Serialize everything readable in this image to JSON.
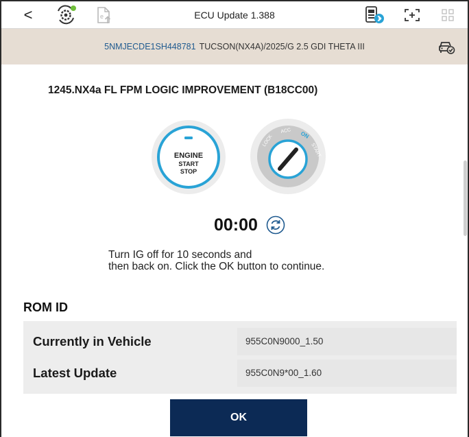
{
  "toolbar": {
    "back_glyph": "<",
    "title": "ECU Update 1.388",
    "icons": [
      "back-icon",
      "scan-gear-icon",
      "upload-file-icon",
      "bluetooth-vci-icon",
      "capture-icon",
      "grid-icon"
    ]
  },
  "vehicle": {
    "vin": "5NMJECDE1SH448781",
    "model": "TUCSON(NX4A)/2025/G 2.5 GDI THETA III"
  },
  "update": {
    "title": "1245.NX4a FL FPM LOGIC IMPROVEMENT (B18CC00)",
    "engine_button": {
      "line1": "ENGINE",
      "line2": "START",
      "line3": "STOP"
    },
    "key_positions": [
      "LOCK",
      "ACC",
      "ON",
      "START"
    ],
    "key_active_position": "ON",
    "timer": "00:00",
    "instruction": "Turn IG off for 10 seconds and\nthen back on. Click the OK button to continue."
  },
  "rom": {
    "label": "ROM ID",
    "rows": [
      {
        "key": "Currently in Vehicle",
        "value": "955C0N9000_1.50"
      },
      {
        "key": "Latest Update",
        "value": "955C0N9*00_1.60"
      }
    ]
  },
  "actions": {
    "ok_label": "OK"
  },
  "colors": {
    "vehicle_bar_bg": "#e6ddd3",
    "vin_text": "#1f5a8f",
    "accent_blue": "#29a3d6",
    "ok_button_bg": "#0c2a55",
    "table_bg": "#ededed"
  }
}
